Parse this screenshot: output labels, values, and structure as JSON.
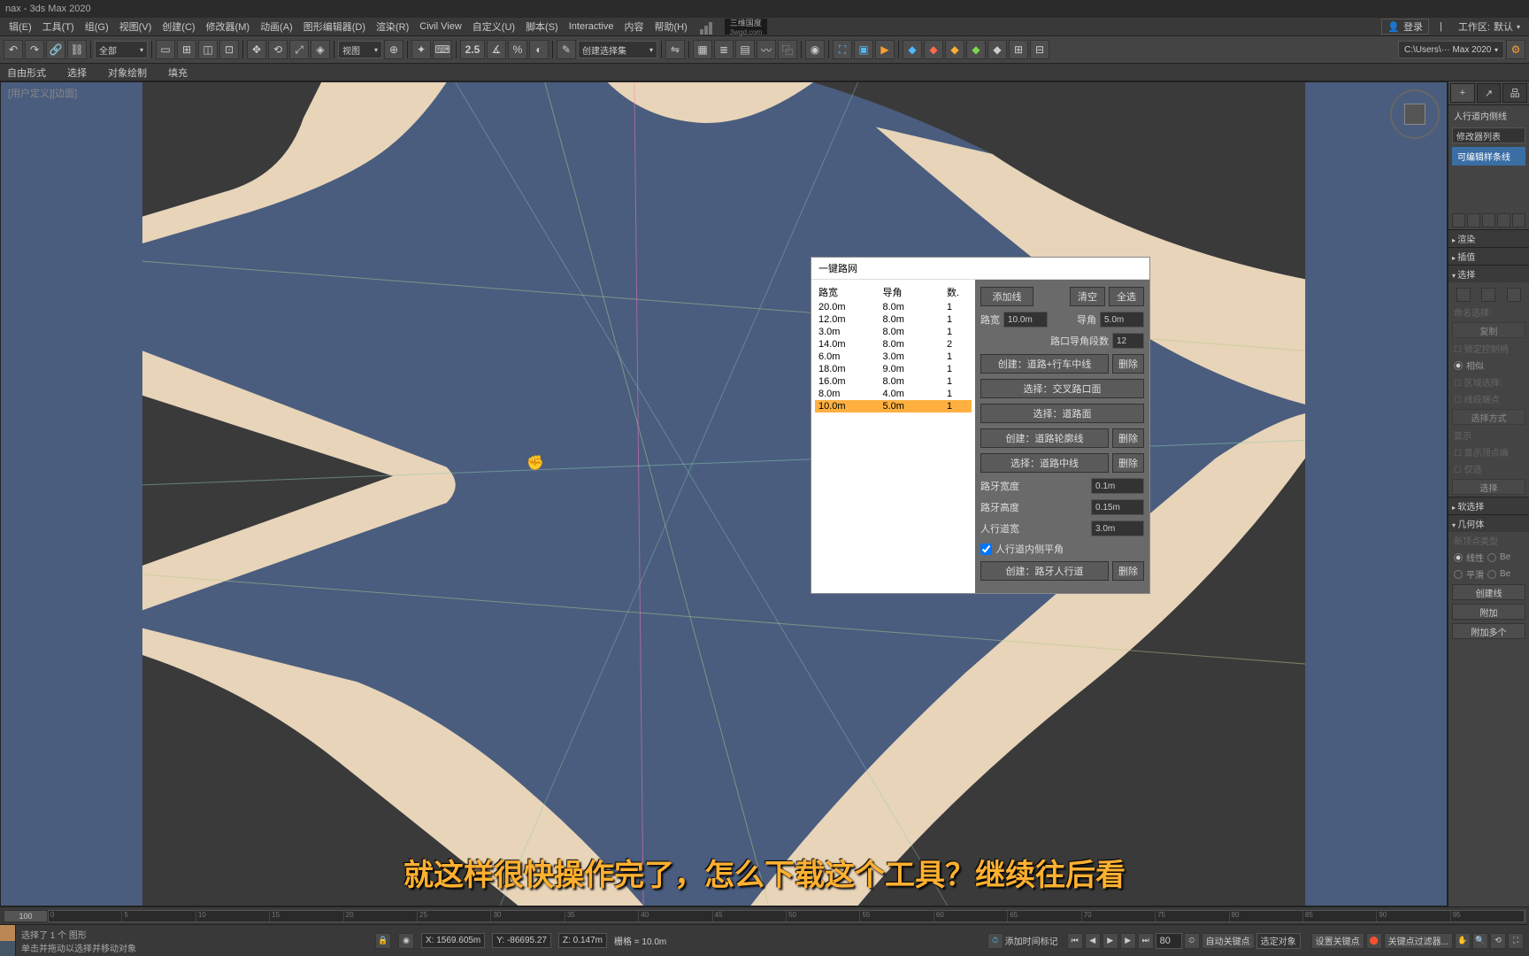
{
  "title": "nax - 3ds Max 2020",
  "menu": [
    "辑(E)",
    "工具(T)",
    "组(G)",
    "视图(V)",
    "创建(C)",
    "修改器(M)",
    "动画(A)",
    "图形编辑器(D)",
    "渲染(R)",
    "Civil View",
    "自定义(U)",
    "脚本(S)",
    "Interactive",
    "内容",
    "帮助(H)"
  ],
  "logo": {
    "top": "三维国度",
    "bottom": "3wgd.com"
  },
  "login": "登录",
  "workspace_label": "工作区:",
  "workspace_value": "默认",
  "toolbar": {
    "dropdown_all": "全部",
    "num25": "2.5",
    "dropdown_view": "视图",
    "dropdown_create_sel": "创建选择集",
    "path": "C:\\Users\\··· Max 2020"
  },
  "toolbar2": [
    "自由形式",
    "选择",
    "对象绘制",
    "填充"
  ],
  "viewport": {
    "label": "[用户定义][边面]"
  },
  "plugin": {
    "title": "一键路网",
    "headers": [
      "路宽",
      "导角",
      "数."
    ],
    "rows": [
      {
        "w": "20.0m",
        "r": "8.0m",
        "n": "1",
        "sel": false
      },
      {
        "w": "12.0m",
        "r": "8.0m",
        "n": "1",
        "sel": false
      },
      {
        "w": "3.0m",
        "r": "8.0m",
        "n": "1",
        "sel": false
      },
      {
        "w": "14.0m",
        "r": "8.0m",
        "n": "2",
        "sel": false
      },
      {
        "w": "6.0m",
        "r": "3.0m",
        "n": "1",
        "sel": false
      },
      {
        "w": "18.0m",
        "r": "9.0m",
        "n": "1",
        "sel": false
      },
      {
        "w": "16.0m",
        "r": "8.0m",
        "n": "1",
        "sel": false
      },
      {
        "w": "8.0m",
        "r": "4.0m",
        "n": "1",
        "sel": false
      },
      {
        "w": "10.0m",
        "r": "5.0m",
        "n": "1",
        "sel": true
      }
    ],
    "btn_add_line": "添加线",
    "btn_clear": "清空",
    "btn_select_all": "全选",
    "label_width": "路宽",
    "val_width": "10.0m",
    "label_radius": "导角",
    "val_radius": "5.0m",
    "label_seg": "路口导角段数",
    "val_seg": "12",
    "btn_create_road": "创建：道路+行车中线",
    "btn_delete": "删除",
    "btn_sel_cross": "选择：交叉路口面",
    "btn_sel_road": "选择：道路面",
    "btn_create_outline": "创建：道路轮廓线",
    "btn_sel_center": "选择：道路中线",
    "label_curb_w": "路牙宽度",
    "val_curb_w": "0.1m",
    "label_curb_h": "路牙高度",
    "val_curb_h": "0.15m",
    "label_walk_w": "人行道宽",
    "val_walk_w": "3.0m",
    "check_inner": "人行道内侧平角",
    "btn_create_walk": "创建：路牙人行道"
  },
  "right_panel": {
    "label_inner_line": "人行道内侧线",
    "label_mod_list": "修改器列表",
    "tree_item": "可编辑样条线",
    "btn_add_line": "添加线",
    "btn_clear": "清空",
    "btn_select_all": "全选",
    "lbl_width": "路宽",
    "val_width": "10.0m",
    "lbl_radius": "导角",
    "val_radius": "5.0m",
    "sec_render": "渲染",
    "sec_interp": "插值",
    "sec_select": "选择",
    "named_sel": "命名选择:",
    "btn_copy": "复制",
    "lock_handles": "锁定控制柄",
    "similar": "相似",
    "area_sel": "区域选择:",
    "seg_end": "线段端点",
    "sel_way": "选择方式",
    "display": "显示",
    "show_vertex": "显示顶点编",
    "only": "仅选",
    "sel_btn": "选择",
    "sec_soft": "软选择",
    "sec_geo": "几何体",
    "new_vertex": "新顶点类型",
    "radio_linear": "线性",
    "radio_smooth": "平滑",
    "radio_be": "Be",
    "btn_create_line": "创建线",
    "btn_attach": "附加",
    "btn_attach_mult": "附加多个"
  },
  "subtitle": "就这样很快操作完了，怎么下载这个工具？继续往后看",
  "timeline": {
    "frame": "100"
  },
  "status": {
    "msg1": "选择了 1 个 图形",
    "msg2": "单击并拖动以选择并移动对象",
    "x": "X: 1569.605m",
    "y": "Y: -86695.27",
    "z": "Z: 0.147m",
    "grid": "栅格 = 10.0m",
    "add_time_tag": "添加时间标记",
    "auto_key": "自动关键点",
    "sel_obj": "选定对象",
    "set_key": "设置关键点",
    "key_filter": "关键点过滤器..."
  }
}
